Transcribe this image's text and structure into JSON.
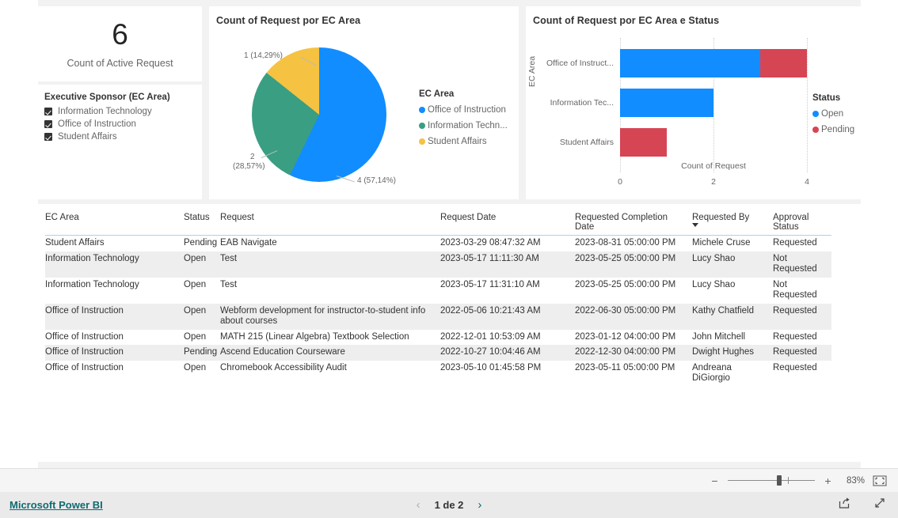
{
  "kpi": {
    "value": "6",
    "label": "Count of Active Request"
  },
  "slicer": {
    "title": "Executive Sponsor (EC Area)",
    "items": [
      {
        "label": "Information Technology",
        "checked": true
      },
      {
        "label": "Office of Instruction",
        "checked": true
      },
      {
        "label": "Student Affairs",
        "checked": true
      }
    ]
  },
  "pie": {
    "title": "Count of Request por EC Area",
    "legend_title": "EC Area",
    "legend": [
      {
        "label": "Office of Instruction",
        "color": "#118DFF"
      },
      {
        "label": "Information Techn...",
        "color": "#3A9E82"
      },
      {
        "label": "Student Affairs",
        "color": "#F5C242"
      }
    ],
    "labels": {
      "student_affairs": "1 (14,29%)",
      "information_technology_l1": "2",
      "information_technology_l2": "(28,57%)",
      "office_of_instruction": "4 (57,14%)"
    }
  },
  "bar": {
    "title": "Count of Request por EC Area e Status",
    "yaxis_title": "EC Area",
    "xaxis_title": "Count of Request",
    "xticks": [
      "0",
      "2",
      "4"
    ],
    "legend_title": "Status",
    "legend": [
      {
        "label": "Open",
        "color": "#118DFF"
      },
      {
        "label": "Pending",
        "color": "#D64554"
      }
    ],
    "categories": [
      "Office of Instruct...",
      "Information Tec...",
      "Student Affairs"
    ]
  },
  "chart_data": [
    {
      "type": "pie",
      "title": "Count of Request por EC Area",
      "categories": [
        "Office of Instruction",
        "Information Technology",
        "Student Affairs"
      ],
      "values": [
        4,
        2,
        1
      ],
      "percentages": [
        57.14,
        28.57,
        14.29
      ],
      "data_labels": [
        "4 (57,14%)",
        "2 (28,57%)",
        "1 (14,29%)"
      ],
      "colors": [
        "#118DFF",
        "#3A9E82",
        "#F5C242"
      ],
      "legend_title": "EC Area",
      "legend_position": "right"
    },
    {
      "type": "bar",
      "orientation": "horizontal",
      "stacked": true,
      "title": "Count of Request por EC Area e Status",
      "categories": [
        "Office of Instruct...",
        "Information Tec...",
        "Student Affairs"
      ],
      "series": [
        {
          "name": "Open",
          "values": [
            3,
            2,
            0
          ],
          "color": "#118DFF"
        },
        {
          "name": "Pending",
          "values": [
            1,
            0,
            1
          ],
          "color": "#D64554"
        }
      ],
      "xlabel": "Count of Request",
      "ylabel": "EC Area",
      "xlim": [
        0,
        4
      ],
      "xticks": [
        0,
        2,
        4
      ],
      "grid": true,
      "legend_title": "Status",
      "legend_position": "right"
    }
  ],
  "table": {
    "columns": [
      "EC Area",
      "Status",
      "Request",
      "Request Date",
      "Requested Completion Date",
      "Requested By",
      "Approval Status"
    ],
    "sorted_column": "Requested By",
    "sort_direction": "desc",
    "rows": [
      [
        "Student Affairs",
        "Pending",
        "EAB Navigate",
        "2023-03-29 08:47:32 AM",
        "2023-08-31 05:00:00 PM",
        "Michele Cruse",
        "Requested"
      ],
      [
        "Information Technology",
        "Open",
        "Test",
        "2023-05-17 11:11:30 AM",
        "2023-05-25 05:00:00 PM",
        "Lucy Shao",
        "Not Requested"
      ],
      [
        "Information Technology",
        "Open",
        "Test",
        "2023-05-17 11:31:10 AM",
        "2023-05-25 05:00:00 PM",
        "Lucy Shao",
        "Not Requested"
      ],
      [
        "Office of Instruction",
        "Open",
        "Webform development for instructor-to-student info about courses",
        "2022-05-06 10:21:43 AM",
        "2022-06-30 05:00:00 PM",
        "Kathy Chatfield",
        "Requested"
      ],
      [
        "Office of Instruction",
        "Open",
        "MATH 215 (Linear Algebra) Textbook Selection",
        "2022-12-01 10:53:09 AM",
        "2023-01-12 04:00:00 PM",
        "John Mitchell",
        "Requested"
      ],
      [
        "Office of Instruction",
        "Pending",
        "Ascend Education Courseware",
        "2022-10-27 10:04:46 AM",
        "2022-12-30 04:00:00 PM",
        "Dwight Hughes",
        "Requested"
      ],
      [
        "Office of Instruction",
        "Open",
        "Chromebook Accessibility Audit",
        "2023-05-10 01:45:58 PM",
        "2023-05-11 05:00:00 PM",
        "Andreana DiGiorgio",
        "Requested"
      ]
    ]
  },
  "zoombar": {
    "minus": "−",
    "plus": "+",
    "percent": "83%",
    "fit_icon": "fit-to-page-icon"
  },
  "footer": {
    "brand": "Microsoft Power BI",
    "page_text": "1 de 2",
    "prev_icon": "‹",
    "next_icon": "›",
    "share_icon": "share-icon",
    "fullscreen_icon": "fullscreen-icon"
  },
  "colors": {
    "blue": "#118DFF",
    "green": "#3A9E82",
    "amber": "#F5C242",
    "red": "#D64554",
    "teal": "#0f6a71"
  }
}
